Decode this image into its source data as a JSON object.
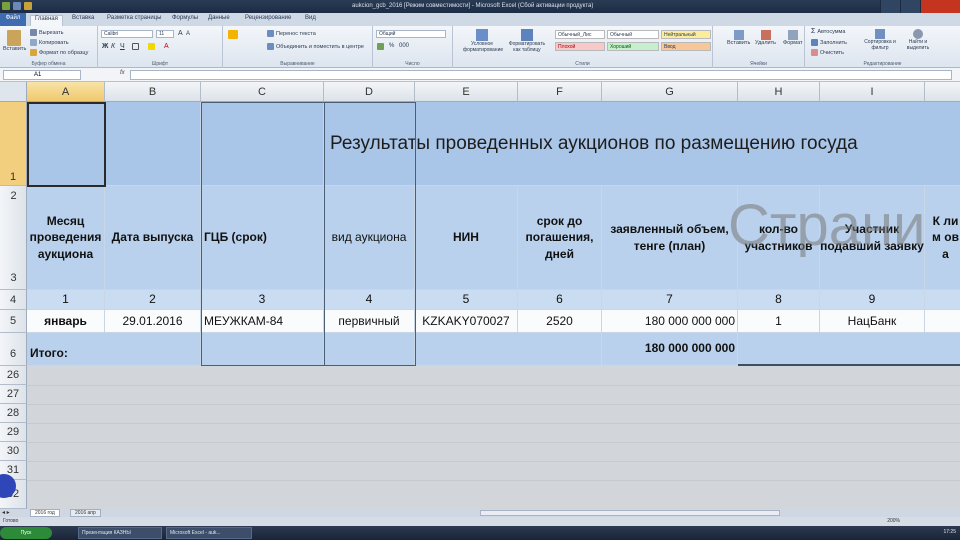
{
  "window": {
    "title": "aukcion_gcb_2016 [Режим совместимости] - Microsoft Excel (Сбой активации продукта)"
  },
  "ribbon_tabs": [
    "Файл",
    "Главная",
    "Вставка",
    "Разметка страницы",
    "Формулы",
    "Данные",
    "Рецензирование",
    "Вид"
  ],
  "ribbon": {
    "paste": "Вставить",
    "cut": "Вырезать",
    "copy": "Копировать",
    "format_painter": "Формат по образцу",
    "clipboard_label": "Буфер обмена",
    "font_name": "Calibri",
    "font_size": "11",
    "font_label": "Шрифт",
    "wrap_text": "Перенос текста",
    "merge_center": "Объединить и поместить в центре",
    "alignment_label": "Выравнивание",
    "number_format": "Общий",
    "number_label": "Число",
    "conditional_formatting": "Условное форматирование",
    "format_as_table": "Форматировать как таблицу",
    "styles": {
      "normal_2": "Обычный_Лис",
      "normal": "Обычный",
      "neutral": "Нейтральный",
      "bad": "Плохой",
      "good": "Хороший",
      "input": "Ввод"
    },
    "styles_label": "Стили",
    "insert": "Вставить",
    "delete": "Удалить",
    "format": "Формат",
    "cells_label": "Ячейки",
    "autosum": "Автосумма",
    "fill": "Заполнить",
    "clear": "Очистить",
    "sort_filter": "Сортировка и фильтр",
    "find_select": "Найти и выделить",
    "editing_label": "Редактирование"
  },
  "formula_bar": {
    "name_box": "A1",
    "fx": "fx",
    "value": ""
  },
  "columns": [
    "A",
    "B",
    "C",
    "D",
    "E",
    "F",
    "G",
    "H",
    "I"
  ],
  "rows_visible": [
    "1",
    "2",
    "3",
    "4",
    "5",
    "6",
    "26",
    "27",
    "28",
    "29",
    "30",
    "31",
    "32"
  ],
  "sheet": {
    "title": "Результаты проведенных аукционов по размещению госуда",
    "headers": [
      "Месяц проведения аукциона",
      "Дата выпуска",
      "ГЦБ (срок)",
      "вид аукциона",
      "НИН",
      "срок до погашения, дней",
      "заявленный объем, тенге (план)",
      "кол-во участников",
      "Участник подавший заявку",
      "К лим ова"
    ],
    "header_numbers": [
      "1",
      "2",
      "3",
      "4",
      "5",
      "6",
      "7",
      "8",
      "9"
    ],
    "data_row": [
      "январь",
      "29.01.2016",
      "МЕУЖКАМ-84",
      "первичный",
      "KZKAKY070027",
      "2520",
      "180 000 000 000",
      "1",
      "НацБанк"
    ],
    "total_label": "Итого:",
    "total_value": "180 000 000 000",
    "watermark": "Страни"
  },
  "sheet_tabs": [
    "2016 год",
    "2016 апр"
  ],
  "status": {
    "ready": "Готово",
    "zoom": "200%"
  },
  "taskbar": {
    "start": "Пуск",
    "items": [
      "Презентация КАЗНЫ",
      "Microsoft Excel - auk..."
    ],
    "clock": "17:25"
  }
}
